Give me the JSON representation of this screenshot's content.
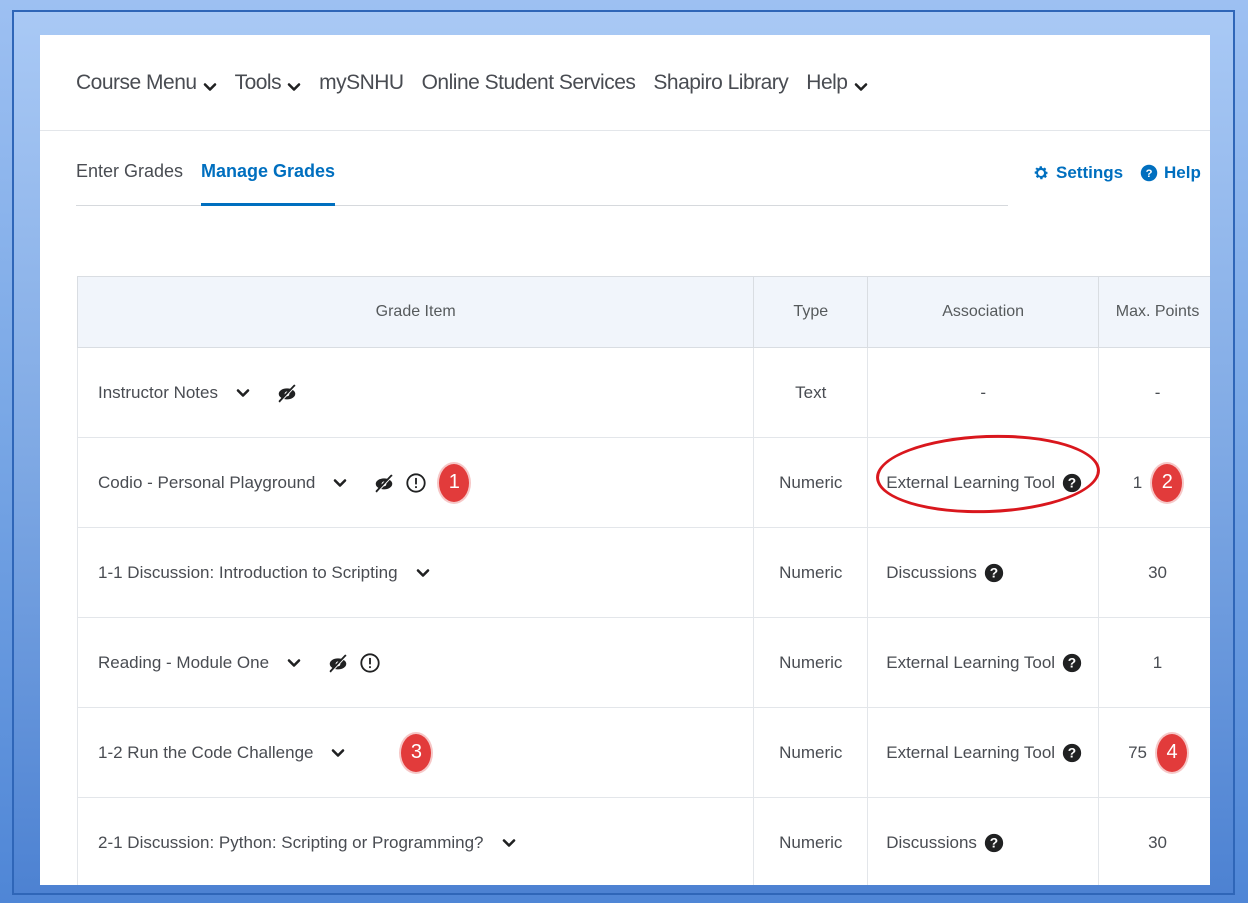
{
  "top_nav": {
    "items": [
      {
        "label": "Course Menu",
        "dropdown": true
      },
      {
        "label": "Tools",
        "dropdown": true
      },
      {
        "label": "mySNHU",
        "dropdown": false
      },
      {
        "label": "Online Student Services",
        "dropdown": false
      },
      {
        "label": "Shapiro Library",
        "dropdown": false
      },
      {
        "label": "Help",
        "dropdown": true
      }
    ]
  },
  "tabs": {
    "enter_grades": "Enter Grades",
    "manage_grades": "Manage Grades",
    "active": "Manage Grades"
  },
  "actions": {
    "settings": "Settings",
    "help": "Help"
  },
  "table": {
    "headers": {
      "grade_item": "Grade Item",
      "type": "Type",
      "association": "Association",
      "max_points": "Max. Points"
    },
    "rows": [
      {
        "name": "Instructor Notes",
        "hidden_icon": true,
        "alert_icon": false,
        "type": "Text",
        "association": "-",
        "assoc_help": false,
        "max_points": "-",
        "badge_left": "",
        "badge_right": ""
      },
      {
        "name": "Codio - Personal Playground",
        "hidden_icon": true,
        "alert_icon": true,
        "type": "Numeric",
        "association": "External Learning Tool",
        "assoc_help": true,
        "max_points": "1",
        "badge_left": "1",
        "badge_right": "2"
      },
      {
        "name": "1-1 Discussion: Introduction to Scripting",
        "hidden_icon": false,
        "alert_icon": false,
        "type": "Numeric",
        "association": "Discussions",
        "assoc_help": true,
        "max_points": "30",
        "badge_left": "",
        "badge_right": ""
      },
      {
        "name": "Reading - Module One",
        "hidden_icon": true,
        "alert_icon": true,
        "type": "Numeric",
        "association": "External Learning Tool",
        "assoc_help": true,
        "max_points": "1",
        "badge_left": "",
        "badge_right": ""
      },
      {
        "name": "1-2 Run the Code Challenge",
        "hidden_icon": false,
        "alert_icon": false,
        "type": "Numeric",
        "association": "External Learning Tool",
        "assoc_help": true,
        "max_points": "75",
        "badge_left": "3",
        "badge_right": "4"
      },
      {
        "name": "2-1 Discussion: Python: Scripting or Programming?",
        "hidden_icon": false,
        "alert_icon": false,
        "type": "Numeric",
        "association": "Discussions",
        "assoc_help": true,
        "max_points": "30",
        "badge_left": "",
        "badge_right": ""
      }
    ]
  },
  "colors": {
    "accent": "#006fbf",
    "badge": "#e23b3b",
    "annotation": "#d9171d"
  }
}
